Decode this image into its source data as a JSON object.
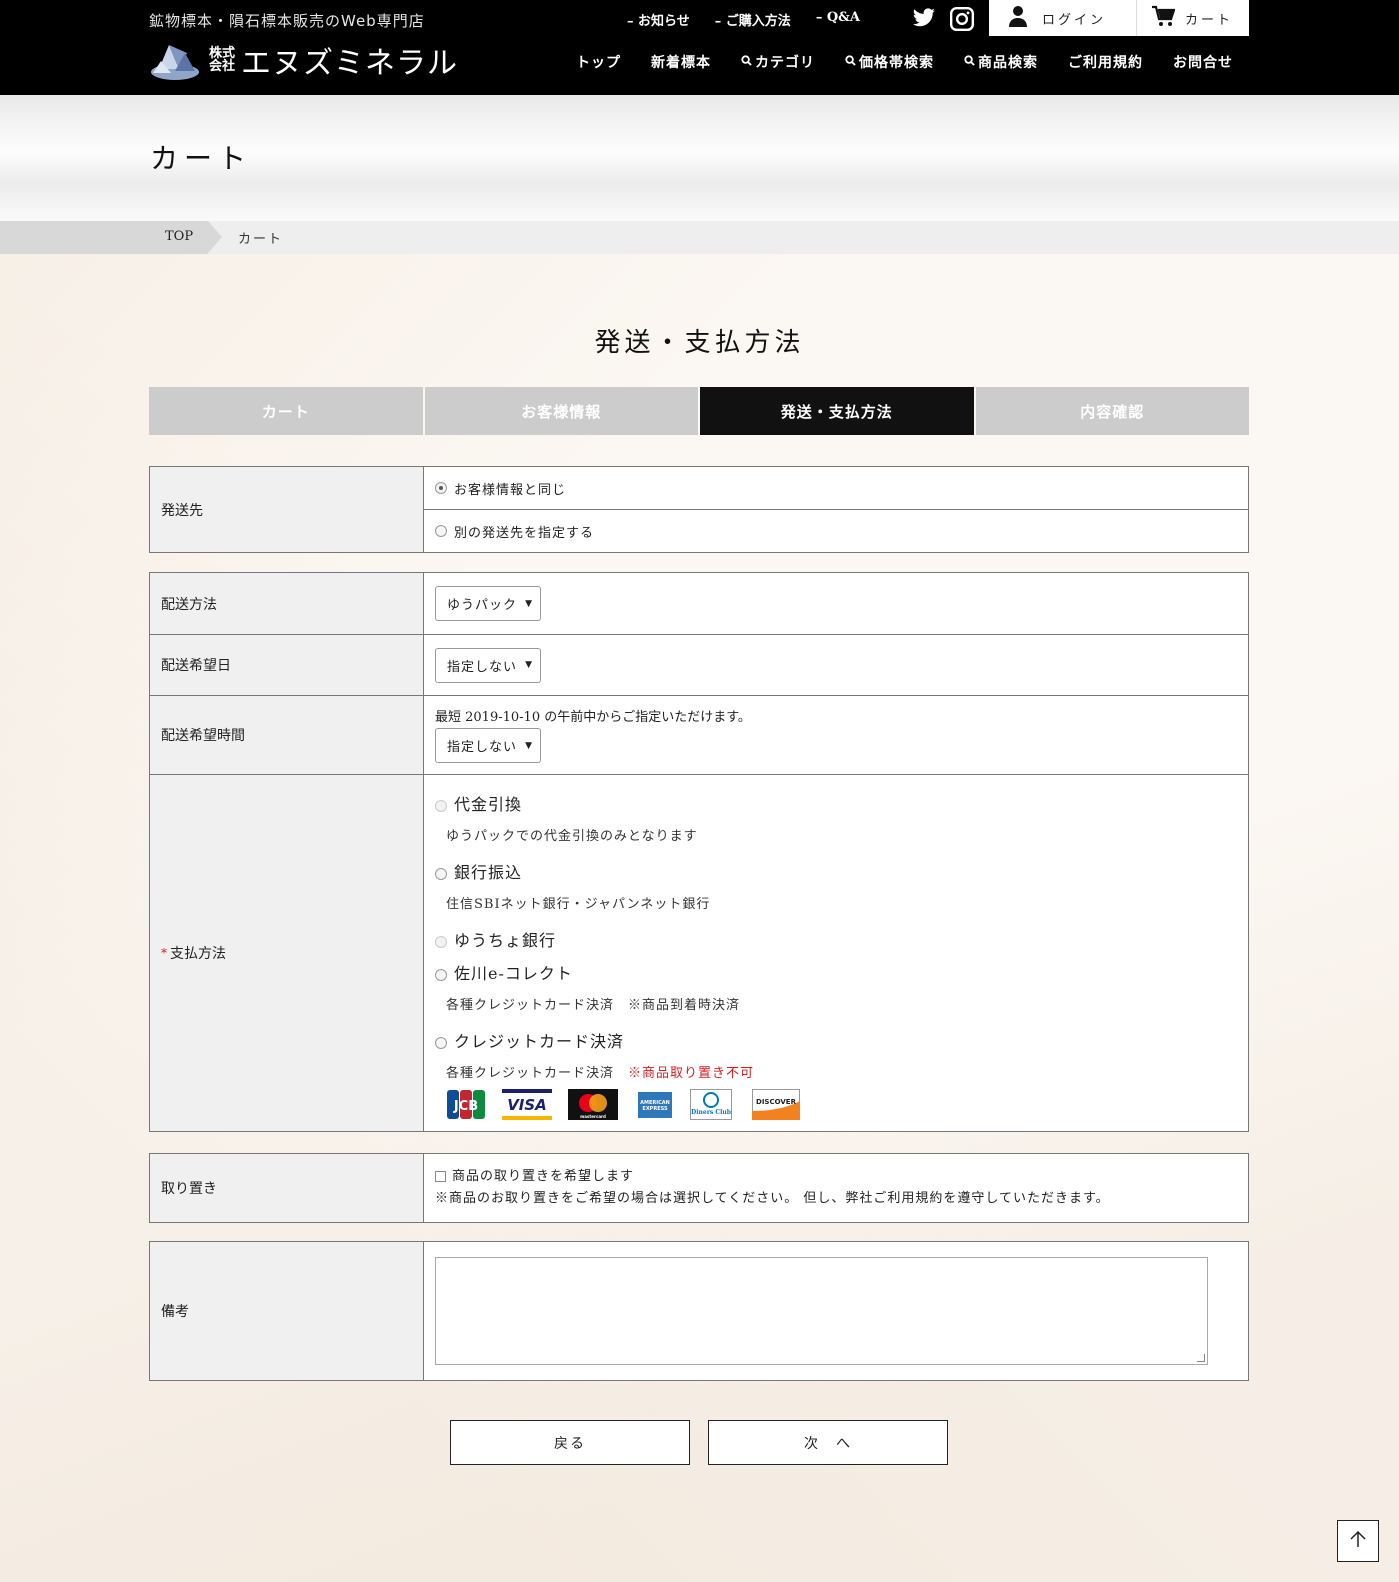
{
  "header": {
    "tagline": "鉱物標本・隕石標本販売のWeb専門店",
    "logo_kk": "株式\n会社",
    "logo_name": "エヌズミネラル",
    "top_links": [
      "– お知らせ",
      "– ご購入方法",
      "– Q&A"
    ],
    "login": "ログイン",
    "cart": "カート",
    "main_nav": [
      "トップ",
      "新着標本",
      "カテゴリ",
      "価格帯検索",
      "商品検索",
      "ご利用規約",
      "お問合せ"
    ]
  },
  "page": {
    "title": "カート",
    "breadcrumb_top": "TOP",
    "breadcrumb_current": "カート",
    "section_title": "発送・支払方法"
  },
  "steps": [
    "カート",
    "お客様情報",
    "発送・支払方法",
    "内容確認"
  ],
  "shipping_to": {
    "label": "発送先",
    "option1": "お客様情報と同じ",
    "option2": "別の発送先を指定する"
  },
  "delivery": {
    "method_label": "配送方法",
    "method_value": "ゆうパック",
    "date_label": "配送希望日",
    "date_value": "指定しない",
    "time_label": "配送希望時間",
    "time_note": "最短 2019-10-10 の午前中からご指定いただけます。",
    "time_value": "指定しない"
  },
  "payment": {
    "label": "支払方法",
    "required_mark": "*",
    "cod_label": "代金引換",
    "cod_note": "ゆうパックでの代金引換のみとなります",
    "bank_label": "銀行振込",
    "bank_note": "住信SBIネット銀行・ジャパンネット銀行",
    "yucho_label": "ゆうちょ銀行",
    "sagawa_label": "佐川e-コレクト",
    "sagawa_note": "各種クレジットカード決済　※商品到着時決済",
    "credit_label": "クレジットカード決済",
    "credit_note": "各種クレジットカード決済",
    "credit_warning": "※商品取り置き不可",
    "card_brands": [
      "JCB",
      "VISA",
      "mastercard",
      "AMERICAN EXPRESS",
      "Diners Club",
      "DISCOVER"
    ]
  },
  "hold": {
    "label": "取り置き",
    "checkbox_label": "商品の取り置きを希望します",
    "note": "※商品のお取り置きをご希望の場合は選択してください。 但し、弊社ご利用規約を遵守していただきます。"
  },
  "remarks": {
    "label": "備考",
    "value": ""
  },
  "buttons": {
    "back": "戻る",
    "next": "次　へ"
  },
  "colors": {
    "header_bg": "#000000",
    "active_step": "#111111",
    "inactive_step": "#cccccc",
    "warning": "#d62020"
  }
}
